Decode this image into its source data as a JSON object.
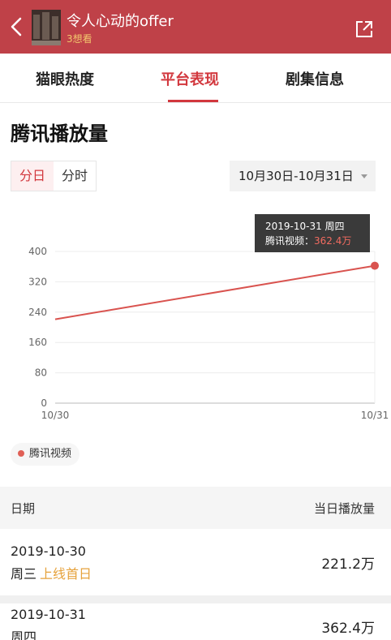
{
  "header": {
    "title": "令人心动的offer",
    "want_count": "3想看"
  },
  "tabs": [
    {
      "label": "猫眼热度",
      "active": false
    },
    {
      "label": "平台表现",
      "active": true
    },
    {
      "label": "剧集信息",
      "active": false
    }
  ],
  "section_title": "腾讯播放量",
  "granularity": {
    "day": "分日",
    "hour": "分时",
    "selected": "分日"
  },
  "date_range": "10月30日-10月31日",
  "tooltip": {
    "date": "2019-10-31 周四",
    "label": "腾讯视频：",
    "value": "362.4万"
  },
  "chart_data": {
    "type": "line",
    "x": [
      "10/30",
      "10/31"
    ],
    "series": [
      {
        "name": "腾讯视频",
        "values": [
          221.2,
          362.4
        ],
        "color": "#d9534f"
      }
    ],
    "yticks": [
      0,
      80,
      160,
      240,
      320,
      400
    ],
    "ylim": [
      0,
      400
    ],
    "grid": true,
    "legend_position": "bottom-left"
  },
  "table": {
    "headers": {
      "date": "日期",
      "plays": "当日播放量"
    },
    "rows": [
      {
        "date": "2019-10-30",
        "weekday": "周三",
        "tag": "上线首日",
        "plays": "221.2万"
      },
      {
        "date": "2019-10-31",
        "weekday": "周四",
        "tag": "",
        "plays": "362.4万"
      }
    ]
  },
  "colors": {
    "brand": "#bf4148",
    "accent": "#d2373d",
    "line": "#d9534f",
    "tag": "#e6a23c"
  }
}
